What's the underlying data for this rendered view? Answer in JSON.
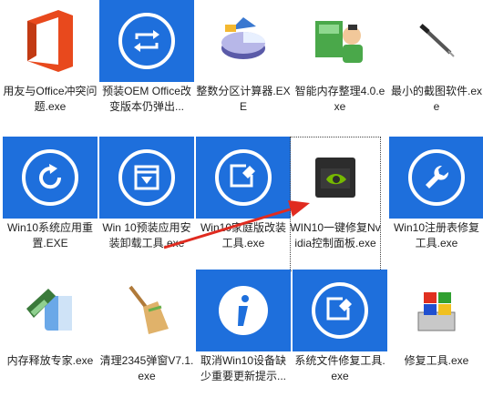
{
  "files": [
    {
      "id": "office",
      "label": "用友与Office冲突问题.exe",
      "icon": "office-logo-icon",
      "tile": "plain"
    },
    {
      "id": "oem",
      "label": "预装OEM Office改变版本仍弹出...",
      "icon": "swap-arrows-icon",
      "tile": "blue"
    },
    {
      "id": "partition",
      "label": "整数分区计算器.EXE",
      "icon": "pie-chart-icon",
      "tile": "plain"
    },
    {
      "id": "memory",
      "label": "智能内存整理4.0.exe",
      "icon": "memory-cleaner-icon",
      "tile": "plain"
    },
    {
      "id": "screenshot",
      "label": "最小的截图软件.exe",
      "icon": "pen-icon",
      "tile": "plain"
    },
    {
      "id": "reset",
      "label": "Win10系统应用重置.EXE",
      "icon": "refresh-icon",
      "tile": "blue"
    },
    {
      "id": "preinstall",
      "label": "Win 10预装应用安装卸载工具.exe",
      "icon": "download-box-icon",
      "tile": "blue"
    },
    {
      "id": "family",
      "label": "Win10家庭版改装工具.exe",
      "icon": "wrench-square-icon",
      "tile": "blue"
    },
    {
      "id": "nvidia",
      "label": "WIN10一键修复Nvidia控制面板.exe",
      "icon": "nvidia-icon",
      "tile": "plain",
      "selected": true
    },
    {
      "id": "registry",
      "label": "Win10注册表修复工具.exe",
      "icon": "wrench-icon",
      "tile": "blue"
    },
    {
      "id": "release",
      "label": "内存释放专家.exe",
      "icon": "mac-finder-icon",
      "tile": "plain"
    },
    {
      "id": "cleanup",
      "label": "清理2345弹窗V7.1.exe",
      "icon": "broom-icon",
      "tile": "plain"
    },
    {
      "id": "updates",
      "label": "取消Win10设备缺少重要更新提示...",
      "icon": "info-icon",
      "tile": "blue"
    },
    {
      "id": "sysfix",
      "label": "系统文件修复工具.exe",
      "icon": "wrench-square-icon",
      "tile": "blue"
    },
    {
      "id": "winsetup",
      "label": "修复工具.exe",
      "icon": "windows-setup-icon",
      "tile": "plain"
    }
  ],
  "colors": {
    "tile_blue": "#1e6fdc",
    "office_red": "#e8491d",
    "arrow_red": "#e02b20",
    "nvidia_green": "#76b900"
  }
}
